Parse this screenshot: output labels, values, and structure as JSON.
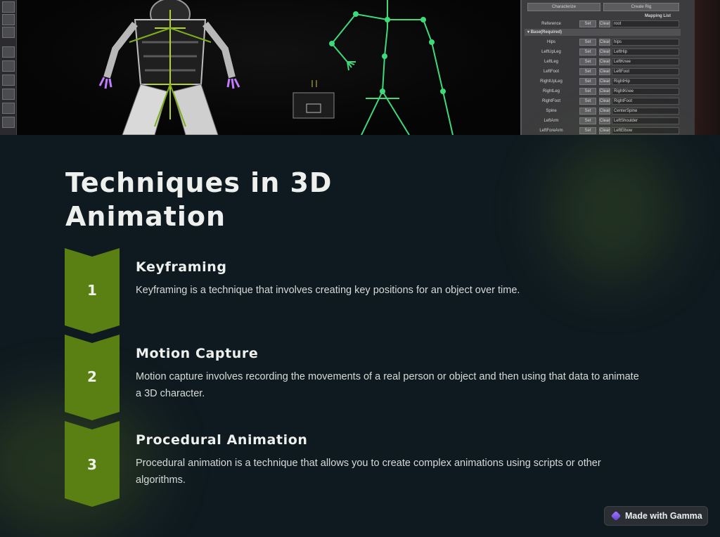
{
  "banner": {
    "panel": {
      "buttons": [
        "Characterize",
        "Create Rig"
      ],
      "heading": "Mapping List",
      "reference": {
        "label": "Reference",
        "set": "Set",
        "clear": "Clear",
        "value": "root"
      },
      "section": "Base(Required)",
      "rows": [
        {
          "label": "Hips",
          "set": "Set",
          "clear": "Clear",
          "value": "hips"
        },
        {
          "label": "LeftUpLeg",
          "set": "Set",
          "clear": "Clear",
          "value": "LeftHip"
        },
        {
          "label": "LeftLeg",
          "set": "Set",
          "clear": "Clear",
          "value": "LeftKnee"
        },
        {
          "label": "LeftFoot",
          "set": "Set",
          "clear": "Clear",
          "value": "LeftFoot"
        },
        {
          "label": "RightUpLeg",
          "set": "Set",
          "clear": "Clear",
          "value": "RightHip"
        },
        {
          "label": "RightLeg",
          "set": "Set",
          "clear": "Clear",
          "value": "RightKnee"
        },
        {
          "label": "RightFoot",
          "set": "Set",
          "clear": "Clear",
          "value": "RightFoot"
        },
        {
          "label": "Spine",
          "set": "Set",
          "clear": "Clear",
          "value": "CenterSpine"
        },
        {
          "label": "LeftArm",
          "set": "Set",
          "clear": "Clear",
          "value": "LeftShoulder"
        },
        {
          "label": "LeftForeArm",
          "set": "Set",
          "clear": "Clear",
          "value": "LeftElbow"
        }
      ]
    }
  },
  "slide": {
    "title": "Techniques in 3D Animation",
    "title_line1": "Techniques in 3D",
    "title_line2": "Animation",
    "accent_color": "#5a7f12",
    "steps": [
      {
        "number": "1",
        "title": "Keyframing",
        "description": "Keyframing is a technique that involves creating key positions for an object over time."
      },
      {
        "number": "2",
        "title": "Motion Capture",
        "description": "Motion capture involves recording the movements of a real person or object and then using that data to animate a 3D character."
      },
      {
        "number": "3",
        "title": "Procedural Animation",
        "description": "Procedural animation is a technique that allows you to create complex animations using scripts or other algorithms."
      }
    ]
  },
  "badge": {
    "label": "Made with Gamma",
    "icon": "gamma-logo-icon"
  }
}
